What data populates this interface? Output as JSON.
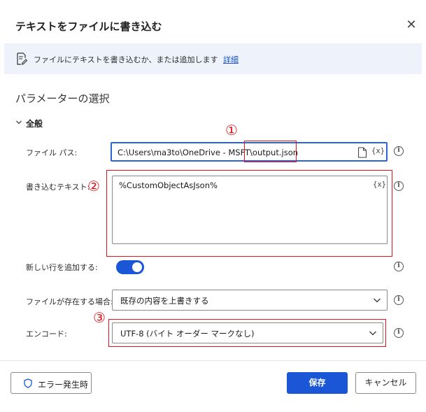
{
  "dialog": {
    "title": "テキストをファイルに書き込む",
    "close_icon": "close-icon"
  },
  "info": {
    "icon": "edit-document-icon",
    "text": "ファイルにテキストを書き込むか、または追加します",
    "link": "詳細"
  },
  "parameters": {
    "section_title": "パラメーターの選択",
    "group_title": "全般",
    "file_path": {
      "label": "ファイル パス:",
      "value_prefix": "C:\\Users\\ma3to\\OneDrive - MSFT\\",
      "value_file": "output.json",
      "hint": "{x}"
    },
    "text_to_write": {
      "label": "書き込むテキスト:",
      "value": "%CustomObjectAsJson%",
      "hint": "{x}"
    },
    "append_newline": {
      "label": "新しい行を追加する:",
      "enabled": true
    },
    "if_file_exists": {
      "label": "ファイルが存在する場合:",
      "selected": "既存の内容を上書きする"
    },
    "encoding": {
      "label": "エンコード:",
      "selected": "UTF-8 (バイト オーダー マークなし)"
    }
  },
  "annotations": [
    "①",
    "②",
    "③"
  ],
  "footer": {
    "error_button": "エラー発生時",
    "save_button": "保存",
    "cancel_button": "キャンセル"
  },
  "colors": {
    "accent": "#1a56d6",
    "annotation_red": "#e0141a",
    "info_bg": "#eef3fb"
  }
}
